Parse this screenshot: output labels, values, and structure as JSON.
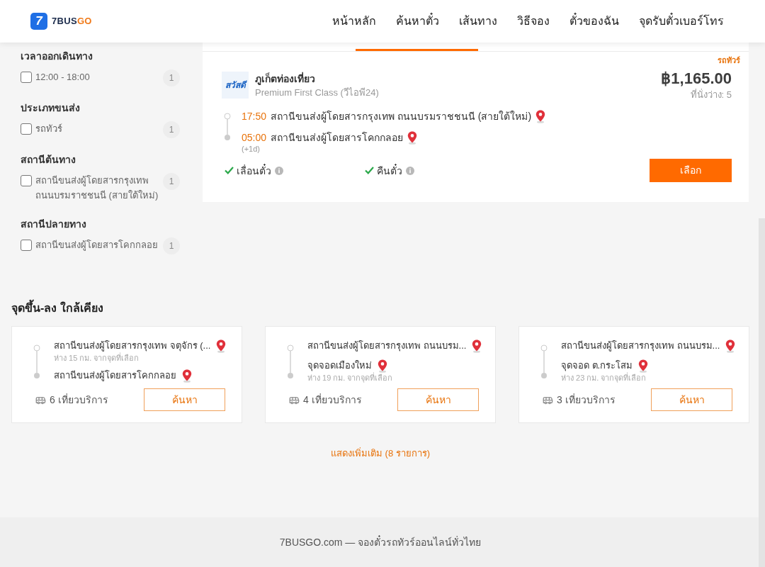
{
  "header": {
    "logo": {
      "mark": "7",
      "text_1": "7BUS",
      "text_2": "GO"
    },
    "nav": [
      "หน้าหลัก",
      "ค้นหาตั๋ว",
      "เส้นทาง",
      "วิธีจอง",
      "ตั๋วของฉัน",
      "จุดรับตั๋วเบอร์โทร"
    ]
  },
  "filters": [
    {
      "title": "เวลาออกเดินทาง",
      "options": [
        {
          "label": "12:00 - 18:00",
          "count": "1",
          "checked": false
        }
      ]
    },
    {
      "title": "ประเภทขนส่ง",
      "options": [
        {
          "label": "รถทัวร์",
          "count": "1",
          "checked": false
        }
      ]
    },
    {
      "title": "สถานีต้นทาง",
      "options": [
        {
          "label": "สถานีขนส่งผู้โดยสารกรุงเทพ ถนนบรมราชชนนี (สายใต้ใหม่)",
          "count": "1",
          "checked": false
        }
      ]
    },
    {
      "title": "สถานีปลายทาง",
      "options": [
        {
          "label": "สถานีขนส่งผู้โดยสารโคกกลอย",
          "count": "1",
          "checked": false
        }
      ]
    }
  ],
  "trip": {
    "tag": "รถทัวร์",
    "operator": {
      "logo_text": "สวัสดี",
      "name": "ภูเก็ตท่องเที่ยว",
      "class": "Premium First Class (วีไอพี24)"
    },
    "price": "฿1,165.00",
    "seats": "ที่นั่งว่าง: 5",
    "stops": [
      {
        "time": "17:50",
        "station": "สถานีขนส่งผู้โดยสารกรุงเทพ ถนนบรมราชชนนี (สายใต้ใหม่)"
      },
      {
        "time": "05:00",
        "day_offset": "(+1d)",
        "station": "สถานีขนส่งผู้โดยสารโคกกลอย"
      }
    ],
    "features": [
      {
        "label": "เลื่อนตั๋ว",
        "available": true
      },
      {
        "label": "คืนตั๋ว",
        "available": true
      }
    ],
    "select_button": "เลือก"
  },
  "nearby": {
    "title": "จุดขึ้น-ลง ใกล้เคียง",
    "routes": [
      {
        "origin": {
          "name": "สถานีขนส่งผู้โดยสารกรุงเทพ จตุจักร (...",
          "distance": "ห่าง 15 กม. จากจุดที่เลือก"
        },
        "destination": {
          "name": "สถานีขนส่งผู้โดยสารโคกกลอย"
        },
        "trips": "6 เที่ยวบริการ",
        "button": "ค้นหา"
      },
      {
        "origin": {
          "name": "สถานีขนส่งผู้โดยสารกรุงเทพ ถนนบรม..."
        },
        "destination": {
          "name": "จุดจอดเมืองใหม่",
          "distance": "ห่าง 19 กม. จากจุดที่เลือก"
        },
        "trips": "4 เที่ยวบริการ",
        "button": "ค้นหา"
      },
      {
        "origin": {
          "name": "สถานีขนส่งผู้โดยสารกรุงเทพ ถนนบรม..."
        },
        "destination": {
          "name": "จุดจอด ต.กระโสม",
          "distance": "ห่าง 23 กม. จากจุดที่เลือก"
        },
        "trips": "3 เที่ยวบริการ",
        "button": "ค้นหา"
      }
    ],
    "more_link": "แสดงเพิ่มเติม (8 รายการ)"
  },
  "footer": {
    "text": "7BUSGO.com — จองตั๋วรถทัวร์ออนไลน์ทั่วไทย"
  }
}
